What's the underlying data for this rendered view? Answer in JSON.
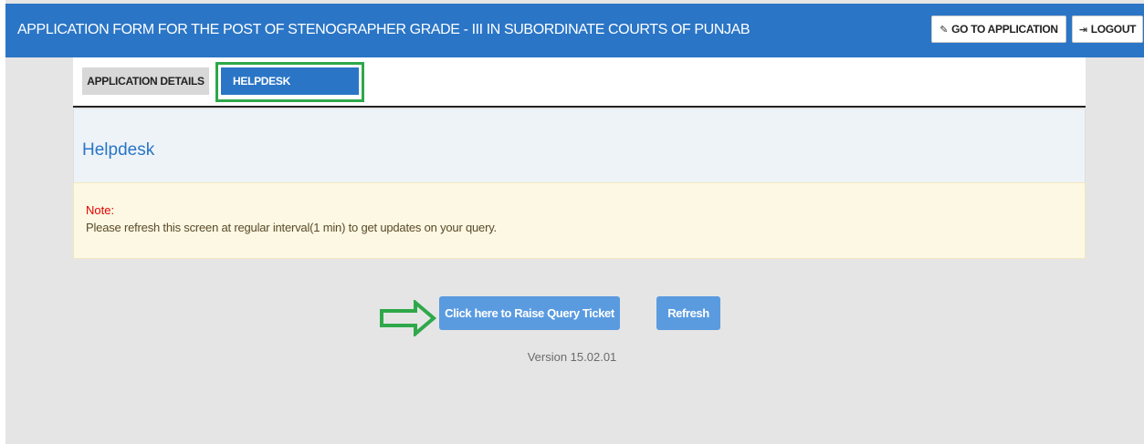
{
  "header": {
    "title": "APPLICATION FORM FOR THE POST OF STENOGRAPHER GRADE - III IN SUBORDINATE COURTS OF PUNJAB",
    "go_to_application": "GO TO APPLICATION",
    "logout": "LOGOUT",
    "go_icon": "✎",
    "logout_icon": "⇥"
  },
  "tabs": [
    {
      "label": "APPLICATION DETAILS",
      "active": false
    },
    {
      "label": "HELPDESK",
      "active": true
    }
  ],
  "main": {
    "heading": "Helpdesk",
    "note_label": "Note:",
    "note_text": "Please refresh this screen at regular interval(1 min) to get updates on your query."
  },
  "actions": {
    "raise_ticket": "Click here to Raise Query Ticket",
    "refresh": "Refresh"
  },
  "footer": {
    "version": "Version 15.02.01"
  },
  "colors": {
    "primary": "#2a75c6",
    "button": "#5a9be0",
    "highlight": "#2ea84a",
    "note_bg": "#fcf8e3",
    "note_label": "#e30000"
  }
}
